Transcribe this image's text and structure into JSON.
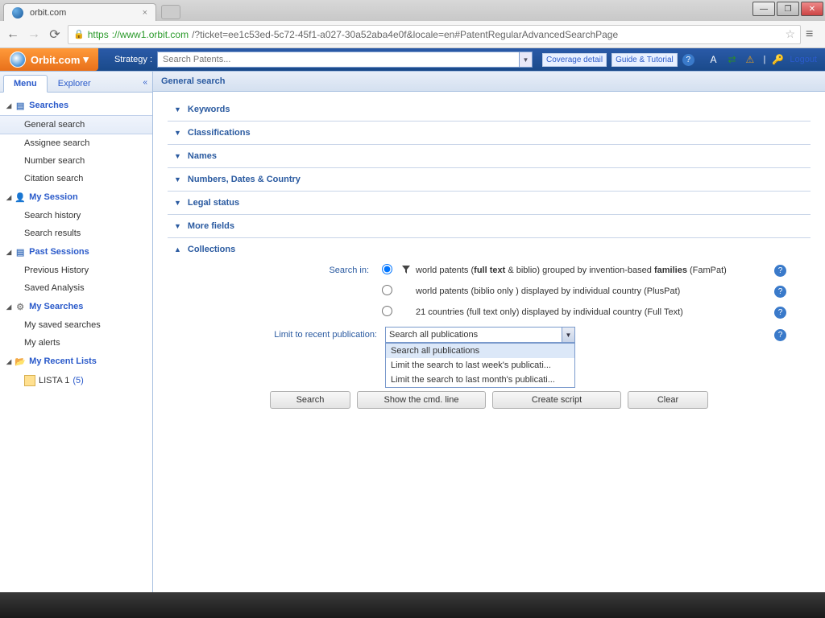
{
  "browser": {
    "tab_title": "orbit.com",
    "url_https": "https",
    "url_host": "://www1.orbit.com",
    "url_rest": "/?ticket=ee1c53ed-5c72-45f1-a027-30a52aba4e0f&locale=en#PatentRegularAdvancedSearchPage"
  },
  "header": {
    "logo": "Orbit.com",
    "logo_caret": "▾",
    "strategy_label": "Strategy :",
    "strategy_placeholder": "Search Patents...",
    "coverage": "Coverage detail",
    "guide": "Guide & Tutorial",
    "logout": "Logout"
  },
  "sidebar": {
    "tab_menu": "Menu",
    "tab_explorer": "Explorer",
    "collapse": "«",
    "groups": [
      {
        "label": "Searches",
        "icon": "🗐",
        "items": [
          "General search",
          "Assignee search",
          "Number search",
          "Citation search"
        ],
        "active_item": 0
      },
      {
        "label": "My Session",
        "icon": "👤",
        "items": [
          "Search history",
          "Search results"
        ]
      },
      {
        "label": "Past Sessions",
        "icon": "🗐",
        "items": [
          "Previous History",
          "Saved Analysis"
        ]
      },
      {
        "label": "My Searches",
        "icon": "⚙",
        "items": [
          "My saved searches",
          "My alerts"
        ]
      },
      {
        "label": "My Recent Lists",
        "icon": "📁",
        "items": []
      }
    ],
    "recent_list": {
      "name": "LISTA 1",
      "count": "(5)"
    }
  },
  "content": {
    "title": "General search",
    "sections": [
      "Keywords",
      "Classifications",
      "Names",
      "Numbers, Dates & Country",
      "Legal status",
      "More fields",
      "Collections"
    ],
    "collections": {
      "search_in_label": "Search in:",
      "opt1_pre": "world patents (",
      "opt1_ft": "full text",
      "opt1_mid": " & biblio) grouped by invention-based ",
      "opt1_fam": "families",
      "opt1_post": " (FamPat)",
      "opt2": "world patents (biblio only ) displayed by individual country (PlusPat)",
      "opt3": "21 countries (full text only) displayed by individual country (Full Text)",
      "limit_label": "Limit to recent publication:",
      "select_value": "Search all publications",
      "options": [
        "Search all publications",
        "Limit the search to last week's publicati...",
        "Limit the search to last month's publicati..."
      ]
    },
    "buttons": {
      "search": "Search",
      "cmd": "Show the cmd. line",
      "script": "Create script",
      "clear": "Clear"
    }
  }
}
